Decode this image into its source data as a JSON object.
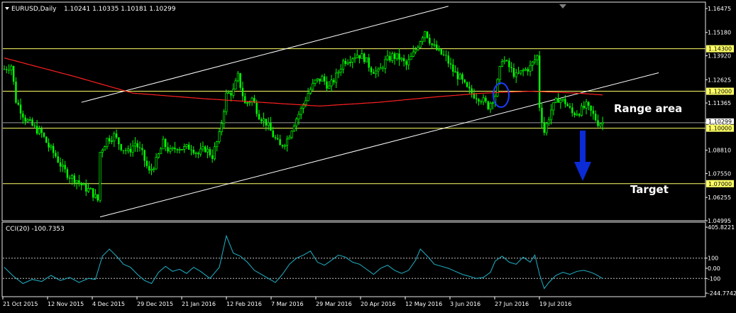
{
  "header": {
    "symbol": "EURUSD,Daily",
    "ohlc": "1.10241 1.10335 1.10181 1.10299"
  },
  "annotations": {
    "range": "Range area",
    "target": "Target"
  },
  "colors": {
    "background": "#000000",
    "candles": "#00ff00",
    "ma": "#ff2020",
    "levels": "#ffff66",
    "channel": "#ffffff",
    "cci": "#20b2c8",
    "arrow": "#0a2bd6",
    "circle": "#1a3cff"
  },
  "chart_data": [
    {
      "type": "candlestick",
      "title": "EURUSD,Daily",
      "x_tick_labels": [
        "21 Oct 2015",
        "12 Nov 2015",
        "4 Dec 2015",
        "29 Dec 2015",
        "21 Jan 2016",
        "12 Feb 2016",
        "7 Mar 2016",
        "29 Mar 2016",
        "20 Apr 2016",
        "12 May 2016",
        "3 Jun 2016",
        "27 Jun 2016",
        "19 Jul 2016"
      ],
      "y_tick_labels": [
        "1.16475",
        "1.15180",
        "1.13920",
        "1.12625",
        "1.11365",
        "1.10299",
        "1.08810",
        "1.07550",
        "1.06255",
        "1.04995"
      ],
      "ylim": [
        1.04995,
        1.16475
      ],
      "current_price": "1.10299",
      "levels": [
        {
          "label": "1.14300",
          "value": 1.143
        },
        {
          "label": "1.12000",
          "value": 1.12
        },
        {
          "label": "1.10000",
          "value": 1.1
        },
        {
          "label": "1.07000",
          "value": 1.07
        }
      ],
      "close_path": [
        [
          0,
          1.132
        ],
        [
          3,
          1.134
        ],
        [
          5,
          1.115
        ],
        [
          9,
          1.105
        ],
        [
          13,
          1.1
        ],
        [
          16,
          1.097
        ],
        [
          19,
          1.09
        ],
        [
          22,
          1.085
        ],
        [
          25,
          1.078
        ],
        [
          28,
          1.074
        ],
        [
          31,
          1.072
        ],
        [
          34,
          1.068
        ],
        [
          37,
          1.066
        ],
        [
          40,
          1.061
        ],
        [
          41,
          1.087
        ],
        [
          44,
          1.094
        ],
        [
          47,
          1.096
        ],
        [
          50,
          1.09
        ],
        [
          53,
          1.087
        ],
        [
          56,
          1.092
        ],
        [
          59,
          1.086
        ],
        [
          62,
          1.076
        ],
        [
          65,
          1.082
        ],
        [
          68,
          1.092
        ],
        [
          71,
          1.087
        ],
        [
          74,
          1.09
        ],
        [
          77,
          1.089
        ],
        [
          80,
          1.09
        ],
        [
          83,
          1.086
        ],
        [
          86,
          1.089
        ],
        [
          89,
          1.085
        ],
        [
          92,
          1.096
        ],
        [
          95,
          1.118
        ],
        [
          98,
          1.12
        ],
        [
          100,
          1.128
        ],
        [
          103,
          1.113
        ],
        [
          106,
          1.116
        ],
        [
          109,
          1.107
        ],
        [
          112,
          1.103
        ],
        [
          115,
          1.096
        ],
        [
          118,
          1.09
        ],
        [
          121,
          1.094
        ],
        [
          124,
          1.103
        ],
        [
          127,
          1.11
        ],
        [
          130,
          1.119
        ],
        [
          133,
          1.125
        ],
        [
          136,
          1.127
        ],
        [
          139,
          1.122
        ],
        [
          142,
          1.128
        ],
        [
          145,
          1.136
        ],
        [
          148,
          1.138
        ],
        [
          151,
          1.14
        ],
        [
          154,
          1.138
        ],
        [
          157,
          1.132
        ],
        [
          160,
          1.13
        ],
        [
          163,
          1.136
        ],
        [
          166,
          1.139
        ],
        [
          169,
          1.138
        ],
        [
          172,
          1.134
        ],
        [
          175,
          1.14
        ],
        [
          178,
          1.148
        ],
        [
          180,
          1.153
        ],
        [
          183,
          1.145
        ],
        [
          186,
          1.141
        ],
        [
          189,
          1.138
        ],
        [
          192,
          1.131
        ],
        [
          195,
          1.127
        ],
        [
          198,
          1.121
        ],
        [
          201,
          1.118
        ],
        [
          204,
          1.116
        ],
        [
          207,
          1.112
        ],
        [
          210,
          1.118
        ],
        [
          213,
          1.138
        ],
        [
          216,
          1.133
        ],
        [
          219,
          1.128
        ],
        [
          222,
          1.131
        ],
        [
          225,
          1.133
        ],
        [
          228,
          1.139
        ],
        [
          229,
          1.112
        ],
        [
          231,
          1.098
        ],
        [
          234,
          1.11
        ],
        [
          237,
          1.116
        ],
        [
          240,
          1.114
        ],
        [
          243,
          1.108
        ],
        [
          246,
          1.109
        ],
        [
          249,
          1.112
        ],
        [
          252,
          1.107
        ],
        [
          254,
          1.103
        ],
        [
          256,
          1.10299
        ]
      ],
      "moving_average": [
        [
          0,
          1.138
        ],
        [
          30,
          1.128
        ],
        [
          55,
          1.119
        ],
        [
          85,
          1.116
        ],
        [
          110,
          1.114
        ],
        [
          135,
          1.112
        ],
        [
          160,
          1.114
        ],
        [
          185,
          1.117
        ],
        [
          205,
          1.119
        ],
        [
          225,
          1.12
        ],
        [
          245,
          1.119
        ],
        [
          256,
          1.118
        ]
      ],
      "channel_lines": [
        {
          "from": [
            33,
            1.114
          ],
          "to": [
            190,
            1.166
          ]
        },
        {
          "from": [
            41,
            1.052
          ],
          "to": [
            280,
            1.13
          ]
        }
      ],
      "x_max": 300,
      "plot_end_index": 256
    },
    {
      "type": "line",
      "title": "CCI(20) -100.7353",
      "name": "CCI(20)",
      "ylim": [
        -244.7742,
        405.8221
      ],
      "y_tick_labels": [
        "405.8221",
        "100",
        "0.00",
        "-100",
        "-244.7742"
      ],
      "reference_levels": [
        100,
        -100
      ],
      "points": [
        [
          0,
          10
        ],
        [
          4,
          -80
        ],
        [
          8,
          -150
        ],
        [
          12,
          -110
        ],
        [
          16,
          -130
        ],
        [
          20,
          -70
        ],
        [
          24,
          -120
        ],
        [
          28,
          -90
        ],
        [
          32,
          -140
        ],
        [
          36,
          -100
        ],
        [
          39,
          -110
        ],
        [
          42,
          120
        ],
        [
          45,
          190
        ],
        [
          48,
          120
        ],
        [
          51,
          40
        ],
        [
          54,
          10
        ],
        [
          57,
          -60
        ],
        [
          60,
          -120
        ],
        [
          63,
          -150
        ],
        [
          66,
          -40
        ],
        [
          69,
          20
        ],
        [
          72,
          -30
        ],
        [
          75,
          -10
        ],
        [
          78,
          -50
        ],
        [
          81,
          10
        ],
        [
          84,
          -30
        ],
        [
          88,
          -100
        ],
        [
          92,
          10
        ],
        [
          95,
          320
        ],
        [
          98,
          150
        ],
        [
          101,
          120
        ],
        [
          104,
          60
        ],
        [
          107,
          -20
        ],
        [
          110,
          -60
        ],
        [
          113,
          -100
        ],
        [
          116,
          -140
        ],
        [
          119,
          -60
        ],
        [
          122,
          40
        ],
        [
          125,
          100
        ],
        [
          128,
          130
        ],
        [
          131,
          170
        ],
        [
          134,
          60
        ],
        [
          137,
          30
        ],
        [
          140,
          80
        ],
        [
          143,
          130
        ],
        [
          146,
          110
        ],
        [
          149,
          60
        ],
        [
          152,
          40
        ],
        [
          155,
          -10
        ],
        [
          158,
          -60
        ],
        [
          161,
          0
        ],
        [
          164,
          30
        ],
        [
          167,
          -20
        ],
        [
          170,
          -50
        ],
        [
          173,
          -20
        ],
        [
          176,
          80
        ],
        [
          178,
          190
        ],
        [
          181,
          120
        ],
        [
          184,
          40
        ],
        [
          187,
          20
        ],
        [
          190,
          0
        ],
        [
          193,
          -30
        ],
        [
          196,
          -60
        ],
        [
          199,
          -80
        ],
        [
          202,
          -100
        ],
        [
          205,
          -90
        ],
        [
          208,
          -40
        ],
        [
          210,
          70
        ],
        [
          213,
          120
        ],
        [
          216,
          60
        ],
        [
          219,
          40
        ],
        [
          222,
          110
        ],
        [
          225,
          60
        ],
        [
          227,
          130
        ],
        [
          229,
          -60
        ],
        [
          231,
          -200
        ],
        [
          233,
          -140
        ],
        [
          236,
          -70
        ],
        [
          239,
          -40
        ],
        [
          242,
          -60
        ],
        [
          245,
          -30
        ],
        [
          248,
          -20
        ],
        [
          251,
          -40
        ],
        [
          253,
          -60
        ],
        [
          256,
          -100.7353
        ]
      ],
      "x_max": 300
    }
  ]
}
